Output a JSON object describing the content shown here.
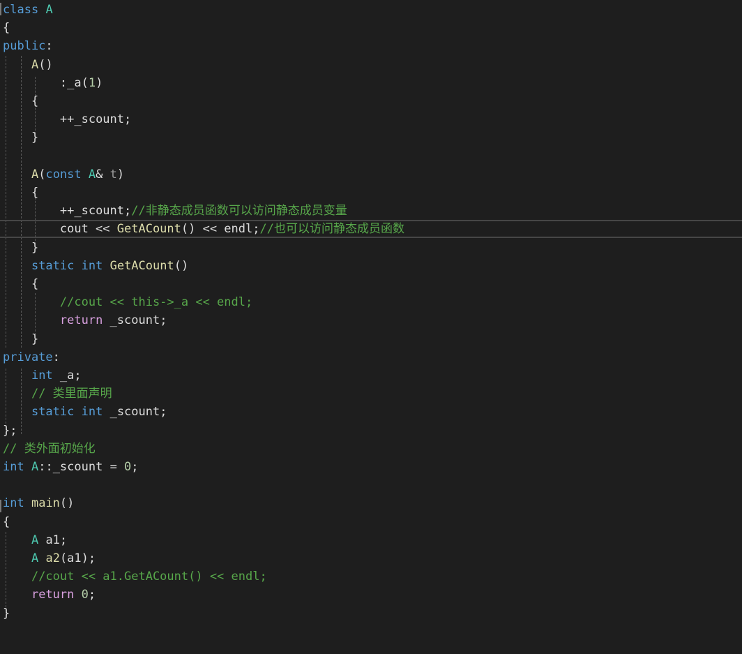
{
  "editor": {
    "background": "#1e1e1e",
    "lines": [
      [
        [
          "kw",
          "class"
        ],
        [
          "txt",
          " "
        ],
        [
          "type",
          "A"
        ]
      ],
      [
        [
          "txt",
          "{"
        ]
      ],
      [
        [
          "kw",
          "public"
        ],
        [
          "txt",
          ":"
        ]
      ],
      [
        [
          "txt",
          "    "
        ],
        [
          "fn",
          "A"
        ],
        [
          "txt",
          "()"
        ]
      ],
      [
        [
          "txt",
          "        :"
        ],
        [
          "txt",
          "_a"
        ],
        [
          "txt",
          "("
        ],
        [
          "num",
          "1"
        ],
        [
          "txt",
          ")"
        ]
      ],
      [
        [
          "txt",
          "    {"
        ]
      ],
      [
        [
          "txt",
          "        ++"
        ],
        [
          "txt",
          "_scount"
        ],
        [
          "txt",
          ";"
        ]
      ],
      [
        [
          "txt",
          "    }"
        ]
      ],
      [
        [
          "txt",
          ""
        ]
      ],
      [
        [
          "txt",
          "    "
        ],
        [
          "fn",
          "A"
        ],
        [
          "txt",
          "("
        ],
        [
          "kw",
          "const"
        ],
        [
          "txt",
          " "
        ],
        [
          "type",
          "A"
        ],
        [
          "txt",
          "& "
        ],
        [
          "pm",
          "t"
        ],
        [
          "txt",
          ")"
        ]
      ],
      [
        [
          "txt",
          "    {"
        ]
      ],
      [
        [
          "txt",
          "        ++"
        ],
        [
          "txt",
          "_scount"
        ],
        [
          "txt",
          ";"
        ],
        [
          "cm",
          "//非静态成员函数可以访问静态成员变量"
        ]
      ],
      [
        [
          "txt",
          "        cout << "
        ],
        [
          "fn",
          "GetACount"
        ],
        [
          "txt",
          "() << endl;"
        ],
        [
          "cm",
          "//也可以访问静态成员函数"
        ]
      ],
      [
        [
          "txt",
          "    }"
        ]
      ],
      [
        [
          "txt",
          "    "
        ],
        [
          "kw",
          "static"
        ],
        [
          "txt",
          " "
        ],
        [
          "kw",
          "int"
        ],
        [
          "txt",
          " "
        ],
        [
          "fn",
          "GetACount"
        ],
        [
          "txt",
          "()"
        ]
      ],
      [
        [
          "txt",
          "    {"
        ]
      ],
      [
        [
          "txt",
          "        "
        ],
        [
          "cm",
          "//cout << this->_a << endl;"
        ]
      ],
      [
        [
          "txt",
          "        "
        ],
        [
          "ctrl",
          "return"
        ],
        [
          "txt",
          " _scount;"
        ]
      ],
      [
        [
          "txt",
          "    }"
        ]
      ],
      [
        [
          "kw",
          "private"
        ],
        [
          "txt",
          ":"
        ]
      ],
      [
        [
          "txt",
          "    "
        ],
        [
          "kw",
          "int"
        ],
        [
          "txt",
          " _a;"
        ]
      ],
      [
        [
          "txt",
          "    "
        ],
        [
          "cm",
          "// 类里面声明"
        ]
      ],
      [
        [
          "txt",
          "    "
        ],
        [
          "kw",
          "static"
        ],
        [
          "txt",
          " "
        ],
        [
          "kw",
          "int"
        ],
        [
          "txt",
          " _scount;"
        ]
      ],
      [
        [
          "txt",
          "};"
        ]
      ],
      [
        [
          "cm",
          "// 类外面初始化"
        ]
      ],
      [
        [
          "kw",
          "int"
        ],
        [
          "txt",
          " "
        ],
        [
          "type",
          "A"
        ],
        [
          "txt",
          "::_scount = "
        ],
        [
          "num",
          "0"
        ],
        [
          "txt",
          ";"
        ]
      ],
      [
        [
          "txt",
          ""
        ]
      ],
      [
        [
          "kw",
          "int"
        ],
        [
          "txt",
          " "
        ],
        [
          "fn",
          "main"
        ],
        [
          "txt",
          "()"
        ]
      ],
      [
        [
          "txt",
          "{"
        ]
      ],
      [
        [
          "txt",
          "    "
        ],
        [
          "type",
          "A"
        ],
        [
          "txt",
          " a1;"
        ]
      ],
      [
        [
          "txt",
          "    "
        ],
        [
          "type",
          "A"
        ],
        [
          "txt",
          " "
        ],
        [
          "fn",
          "a2"
        ],
        [
          "txt",
          "(a1);"
        ]
      ],
      [
        [
          "txt",
          "    "
        ],
        [
          "cm",
          "//cout << a1.GetACount() << endl;"
        ]
      ],
      [
        [
          "txt",
          "    "
        ],
        [
          "ctrl",
          "return"
        ],
        [
          "txt",
          " "
        ],
        [
          "num",
          "0"
        ],
        [
          "txt",
          ";"
        ]
      ],
      [
        [
          "txt",
          "}"
        ]
      ]
    ]
  }
}
